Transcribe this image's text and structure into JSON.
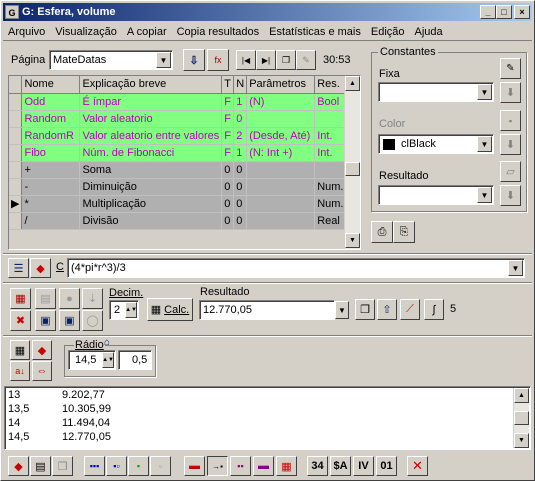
{
  "window": {
    "title": "G: Esfera, volume",
    "app_icon": "G"
  },
  "menu": [
    "Arquivo",
    "Visualização",
    "A copiar",
    "Copia resultados",
    "Estatísticas e mais",
    "Edição",
    "Ajuda"
  ],
  "toolbar": {
    "page_label": "Página",
    "page_value": "MateDatas",
    "time": "30:53"
  },
  "grid": {
    "headers": [
      "Nome",
      "Explicação breve",
      "T",
      "N",
      "Parâmetros",
      "Res."
    ],
    "rows": [
      {
        "style": "g",
        "cells": [
          "Odd",
          "É ímpar",
          "F",
          "1",
          "(N)",
          "Bool"
        ]
      },
      {
        "style": "g",
        "cells": [
          "Random",
          "Valor aleatorio",
          "F",
          "0",
          "",
          ""
        ]
      },
      {
        "style": "g",
        "cells": [
          "RandomR",
          "Valor aleatorio entre valores",
          "F",
          "2",
          "(Desde, Até)",
          "Int."
        ]
      },
      {
        "style": "g",
        "cells": [
          "Fibo",
          "Núm. de Fibonacci",
          "F",
          "1",
          "(N: Int +)",
          "Int."
        ]
      },
      {
        "style": "s",
        "cells": [
          "+",
          "Soma",
          "0",
          "0",
          "",
          ""
        ]
      },
      {
        "style": "s",
        "cells": [
          "-",
          "Diminuição",
          "0",
          "0",
          "",
          "Num."
        ]
      },
      {
        "style": "s",
        "marker": true,
        "cells": [
          "*",
          "Multiplicação",
          "0",
          "0",
          "",
          "Num."
        ]
      },
      {
        "style": "s",
        "cells": [
          "/",
          "Divisão",
          "0",
          "0",
          "",
          "Real"
        ]
      }
    ]
  },
  "constantes": {
    "title": "Constantes",
    "fixa_label": "Fixa",
    "color_label": "Color",
    "color_value": "clBlack",
    "resultado_label": "Resultado"
  },
  "formula": {
    "label": "C",
    "value": "(4*pi*r^3)/3"
  },
  "calc": {
    "decim_label": "Decim.",
    "decim_value": "2",
    "calc_button": "Calc.",
    "resultado_label": "Resultado",
    "resultado_value": "12.770,05",
    "count": "5"
  },
  "radio": {
    "label": "Rádio",
    "value1": "14,5",
    "value2": "0,5"
  },
  "results": [
    [
      "13",
      "9.202,77"
    ],
    [
      "13,5",
      "10.305,99"
    ],
    [
      "14",
      "11.494,04"
    ],
    [
      "14,5",
      "12.770,05"
    ]
  ],
  "bottom": {
    "b34": "34",
    "bsa": "$A",
    "biv": "IV",
    "b01": "01"
  }
}
